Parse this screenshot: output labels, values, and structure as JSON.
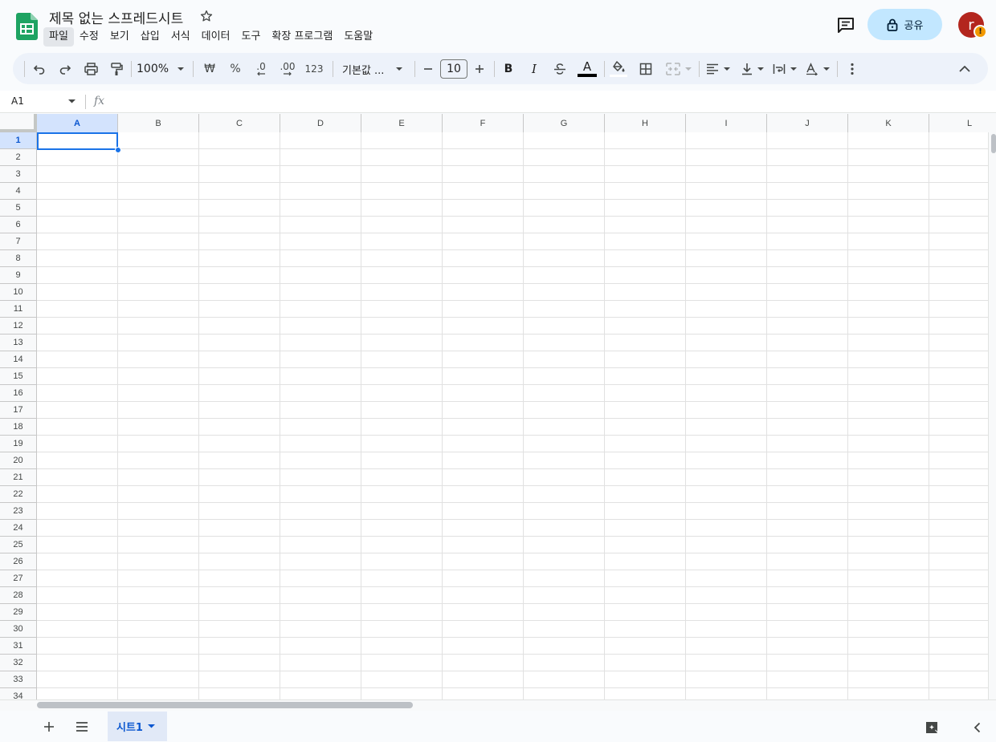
{
  "header": {
    "title": "제목 없는 스프레드시트",
    "menu": [
      "파일",
      "수정",
      "보기",
      "삽입",
      "서식",
      "데이터",
      "도구",
      "확장 프로그램",
      "도움말"
    ],
    "share_label": "공유",
    "avatar_letter": "r",
    "avatar_badge": "!"
  },
  "toolbar": {
    "zoom": "100%",
    "currency": "₩",
    "percent": "%",
    "decrease_decimal": ".0",
    "increase_decimal": ".00",
    "number_format": "123",
    "font": "기본값 ...",
    "font_size": "10",
    "bold": "B",
    "italic": "I",
    "text_color_letter": "A"
  },
  "formula_bar": {
    "name_box": "A1",
    "fx": "fx"
  },
  "grid": {
    "columns": [
      "A",
      "B",
      "C",
      "D",
      "E",
      "F",
      "G",
      "H",
      "I",
      "J",
      "K",
      "L"
    ],
    "rows": [
      "1",
      "2",
      "3",
      "4",
      "5",
      "6",
      "7",
      "8",
      "9",
      "10",
      "11",
      "12",
      "13",
      "14",
      "15",
      "16",
      "17",
      "18",
      "19",
      "20",
      "21",
      "22",
      "23",
      "24",
      "25",
      "26",
      "27",
      "28",
      "29",
      "30",
      "31",
      "32",
      "33",
      "34"
    ],
    "selected_cell": "A1"
  },
  "sheets": {
    "tabs": [
      "시트1"
    ]
  },
  "colors": {
    "accent": "#0b57d0",
    "share_bg": "#c2e7ff",
    "avatar": "#b3261e",
    "badge": "#f29900",
    "selection": "#1a73e8"
  }
}
